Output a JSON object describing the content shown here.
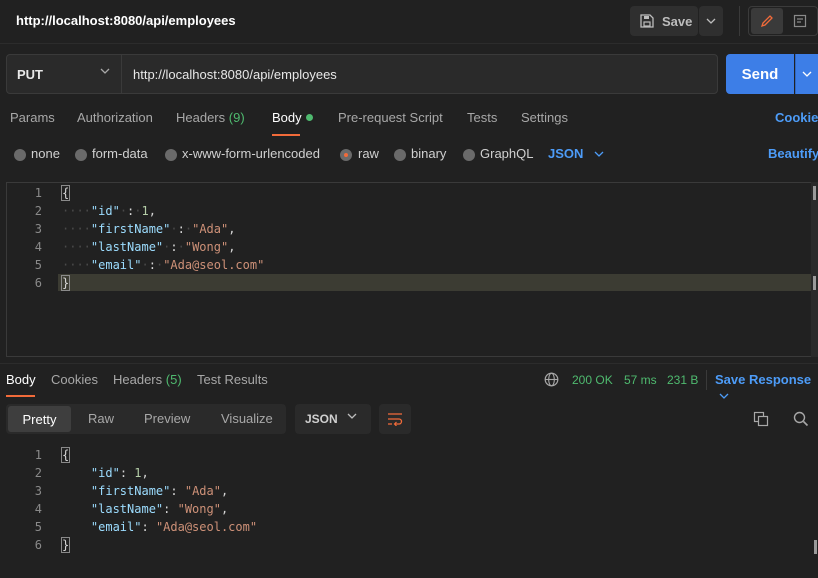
{
  "header": {
    "title": "http://localhost:8080/api/employees",
    "save_label": "Save"
  },
  "request": {
    "method": "PUT",
    "url": "http://localhost:8080/api/employees",
    "send_label": "Send"
  },
  "request_tabs": {
    "params": "Params",
    "authorization": "Authorization",
    "headers": "Headers",
    "headers_count": "(9)",
    "body": "Body",
    "pre_request": "Pre-request Script",
    "tests": "Tests",
    "settings": "Settings",
    "cookies": "Cookies"
  },
  "body_types": {
    "none": "none",
    "form_data": "form-data",
    "urlencoded": "x-www-form-urlencoded",
    "raw": "raw",
    "binary": "binary",
    "graphql": "GraphQL",
    "format": "JSON",
    "beautify": "Beautify",
    "selected": "raw"
  },
  "request_body": {
    "line_numbers": [
      "1",
      "2",
      "3",
      "4",
      "5",
      "6"
    ],
    "open_brace": "{",
    "close_brace": "}",
    "fields": [
      {
        "key": "\"id\"",
        "value": "1",
        "kind": "num",
        "trail": ","
      },
      {
        "key": "\"firstName\"",
        "value": "\"Ada\"",
        "kind": "str",
        "trail": ","
      },
      {
        "key": "\"lastName\"",
        "value": "\"Wong\"",
        "kind": "str",
        "trail": ","
      },
      {
        "key": "\"email\"",
        "value": "\"Ada@seol.com\"",
        "kind": "str",
        "trail": ""
      }
    ]
  },
  "response_tabs": {
    "body": "Body",
    "cookies": "Cookies",
    "headers": "Headers",
    "headers_count": "(5)",
    "test_results": "Test Results"
  },
  "response_meta": {
    "status": "200 OK",
    "time": "57 ms",
    "size": "231 B",
    "save_response": "Save Response"
  },
  "response_view": {
    "pretty": "Pretty",
    "raw": "Raw",
    "preview": "Preview",
    "visualize": "Visualize",
    "format": "JSON"
  },
  "response_body": {
    "line_numbers": [
      "1",
      "2",
      "3",
      "4",
      "5",
      "6"
    ],
    "open_brace": "{",
    "close_brace": "}",
    "fields": [
      {
        "key": "\"id\"",
        "value": "1",
        "kind": "num",
        "trail": ","
      },
      {
        "key": "\"firstName\"",
        "value": "\"Ada\"",
        "kind": "str",
        "trail": ","
      },
      {
        "key": "\"lastName\"",
        "value": "\"Wong\"",
        "kind": "str",
        "trail": ","
      },
      {
        "key": "\"email\"",
        "value": "\"Ada@seol.com\"",
        "kind": "str",
        "trail": ""
      }
    ]
  },
  "colors": {
    "accent_blue": "#3d7ee7",
    "link_blue": "#4d9cf8",
    "active_orange": "#f26b3a",
    "success_green": "#4fba6f"
  },
  "icons": [
    "save-icon",
    "chevron-down-icon",
    "pencil-icon",
    "comment-icon",
    "globe-icon",
    "wrap-lines-icon",
    "copy-icon",
    "search-icon"
  ]
}
